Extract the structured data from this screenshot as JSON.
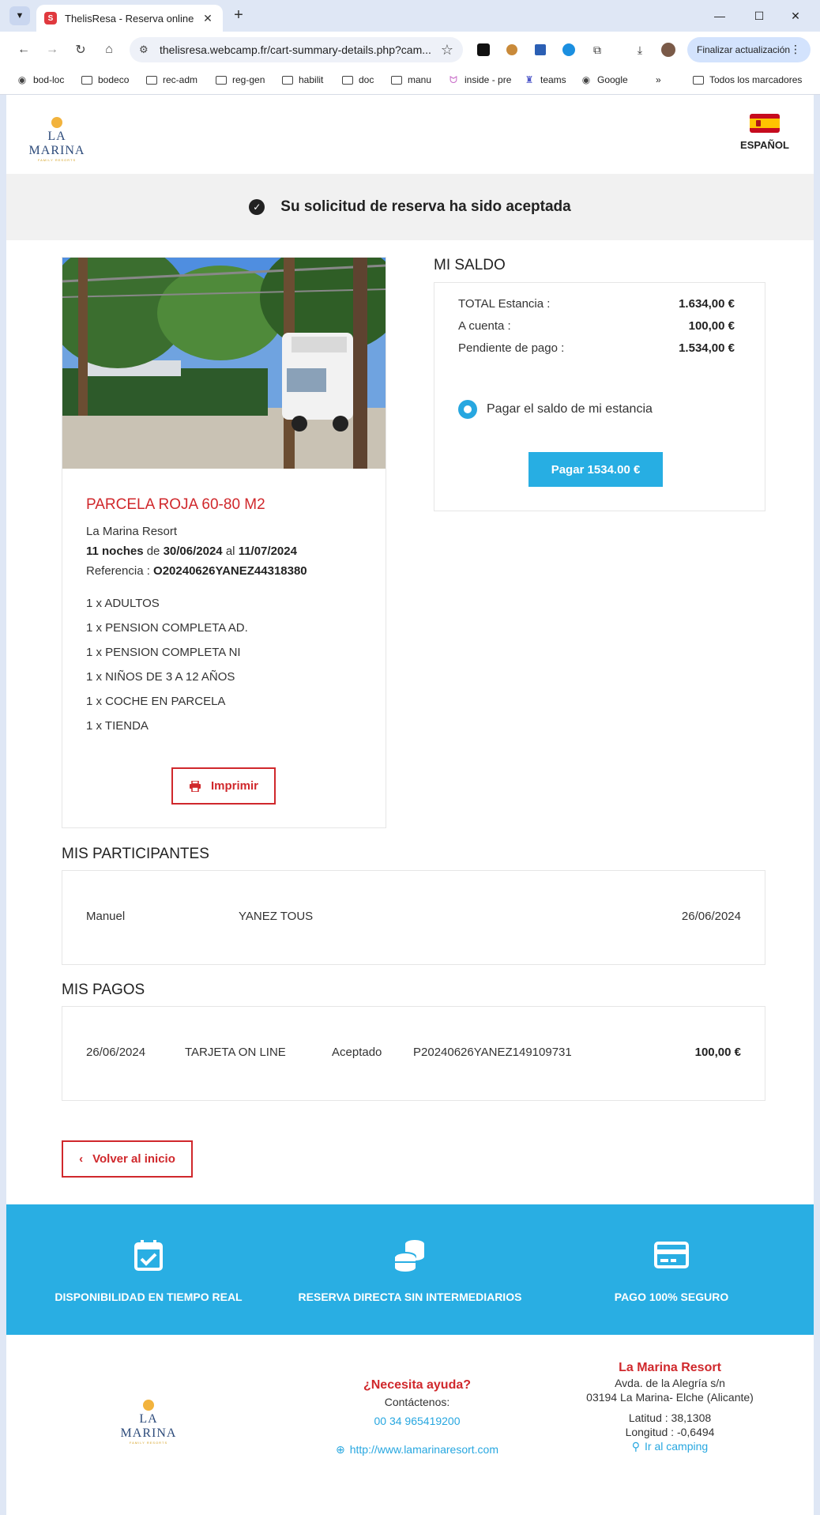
{
  "browser": {
    "tab_title": "ThelisResa - Reserva online",
    "url": "thelisresa.webcamp.fr/cart-summary-details.php?cam...",
    "update_label": "Finalizar actualización",
    "bookmarks": [
      "bod-loc",
      "bodeco",
      "rec-adm",
      "reg-gen",
      "habilit",
      "doc",
      "manu",
      "inside - pre",
      "teams",
      "Google"
    ],
    "all_bookmarks": "Todos los marcadores"
  },
  "header": {
    "logo_text": "LA MARINA",
    "logo_sub": "FAMILY RESORTS",
    "language": "ESPAÑOL"
  },
  "banner": {
    "message": "Su solicitud de reserva ha sido aceptada"
  },
  "stay": {
    "title": "PARCELA ROJA 60-80 M2",
    "resort": "La Marina Resort",
    "nights": "11 noches",
    "from_word": "de",
    "from_date": "30/06/2024",
    "to_word": "al",
    "to_date": "11/07/2024",
    "reference_label": "Referencia :",
    "reference": "O20240626YANEZ44318380",
    "items": [
      "1 x ADULTOS",
      "1 x PENSION COMPLETA AD.",
      "1 x PENSION COMPLETA NI",
      "1 x NIÑOS DE 3 A 12 AÑOS",
      "1 x COCHE EN PARCELA",
      "1 x TIENDA"
    ],
    "print_label": "Imprimir"
  },
  "balance": {
    "title": "MI SALDO",
    "rows": [
      {
        "label": "TOTAL Estancia :",
        "value": "1.634,00 €"
      },
      {
        "label": "A cuenta :",
        "value": "100,00 €"
      },
      {
        "label": "Pendiente de pago :",
        "value": "1.534,00 €"
      }
    ],
    "option_label": "Pagar el saldo de mi estancia",
    "pay_label": "Pagar 1534.00 €"
  },
  "participants": {
    "title": "MIS PARTICIPANTES",
    "rows": [
      {
        "first_name": "Manuel",
        "last_name": "YANEZ TOUS",
        "date": "26/06/2024"
      }
    ]
  },
  "payments": {
    "title": "MIS PAGOS",
    "rows": [
      {
        "date": "26/06/2024",
        "method": "TARJETA ON LINE",
        "status": "Aceptado",
        "reference": "P20240626YANEZ149109731",
        "amount": "100,00 €"
      }
    ]
  },
  "back_label": "Volver al inicio",
  "features": [
    {
      "icon": "calendar-check-icon",
      "label": "DISPONIBILIDAD EN TIEMPO REAL"
    },
    {
      "icon": "coins-icon",
      "label": "RESERVA DIRECTA SIN INTERMEDIARIOS"
    },
    {
      "icon": "credit-card-icon",
      "label": "PAGO 100% SEGURO"
    }
  ],
  "footer": {
    "help_title": "¿Necesita ayuda?",
    "contact": "Contáctenos:",
    "phone": "00 34 965419200",
    "website": "http://www.lamarinaresort.com",
    "resort_name": "La Marina Resort",
    "address1": "Avda. de la Alegría s/n",
    "address2": "03194 La Marina- Elche (Alicante)",
    "latitude": "Latitud : 38,1308",
    "longitude": "Longitud : -0,6494",
    "directions": "Ir al camping"
  },
  "colors": {
    "accent_red": "#d0282c",
    "accent_blue": "#29aee3"
  }
}
